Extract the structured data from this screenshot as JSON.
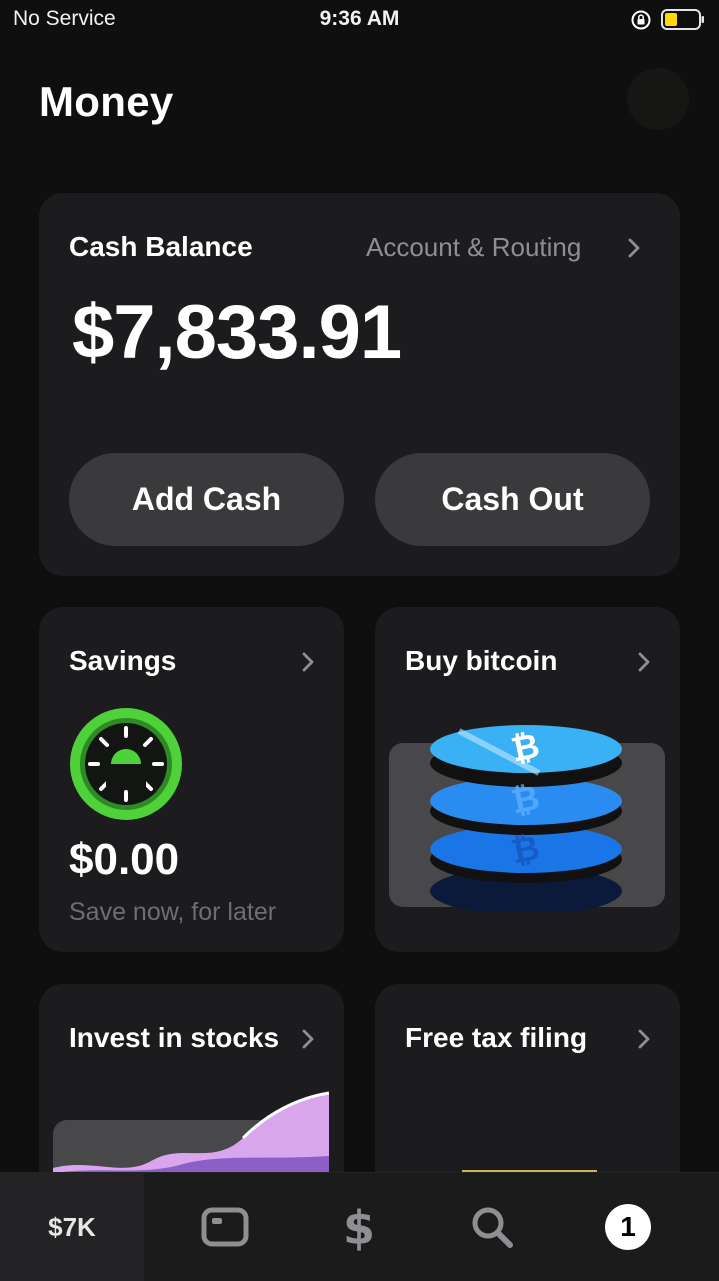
{
  "status_bar": {
    "carrier": "No Service",
    "time": "9:36 AM",
    "lock_icon": "orientation-lock-icon",
    "battery_icon": "battery-icon",
    "battery_color": "#ffd60a"
  },
  "header": {
    "title": "Money",
    "avatar_icon": "avatar"
  },
  "balance_card": {
    "label": "Cash Balance",
    "link": "Account & Routing",
    "amount": "$7,833.91",
    "add_cash": "Add Cash",
    "cash_out": "Cash Out"
  },
  "savings_card": {
    "title": "Savings",
    "icon": "savings-sun-icon",
    "amount": "$0.00",
    "subtitle": "Save now, for later"
  },
  "bitcoin_card": {
    "title": "Buy bitcoin",
    "icon": "bitcoin-coins-icon"
  },
  "stocks_card": {
    "title": "Invest in stocks"
  },
  "tax_card": {
    "title": "Free tax filing"
  },
  "tab_bar": {
    "money_label": "$7K",
    "activity_icon": "activity-icon",
    "pay_icon": "dollar-icon",
    "search_icon": "search-icon",
    "notifications_count": "1"
  },
  "colors": {
    "background": "#0f0f10",
    "card": "#1c1c1e",
    "button": "#3a3a3c",
    "savings_green": "#4fd13a",
    "bitcoin_blue": "#1e90ff",
    "stocks_purple": "#b58ce8"
  }
}
